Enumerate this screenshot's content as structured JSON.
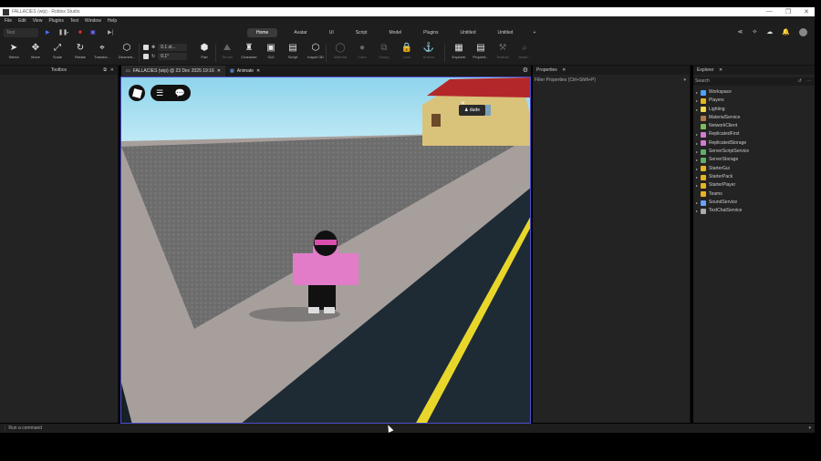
{
  "window": {
    "title": "FALLACIES (wip) - Roblox Studio",
    "controls": [
      "—",
      "❐",
      "✕"
    ]
  },
  "menu": [
    "File",
    "Edit",
    "View",
    "Plugins",
    "Test",
    "Window",
    "Help"
  ],
  "test_select": "Test",
  "ribbon_tabs": [
    {
      "label": "Home",
      "active": true
    },
    {
      "label": "Avatar",
      "active": false
    },
    {
      "label": "UI",
      "active": false
    },
    {
      "label": "Script",
      "active": false
    },
    {
      "label": "Model",
      "active": false
    },
    {
      "label": "Plugins",
      "active": false
    },
    {
      "label": "Untitled",
      "active": false
    },
    {
      "label": "Untitled",
      "active": false
    }
  ],
  "tools": [
    {
      "label": "Select",
      "icon": "cursor-icon",
      "glyph": "➤"
    },
    {
      "label": "Move",
      "icon": "move-icon",
      "glyph": "✥"
    },
    {
      "label": "Scale",
      "icon": "scale-icon",
      "glyph": "⤢"
    },
    {
      "label": "Rotate",
      "icon": "rotate-icon",
      "glyph": "↻"
    },
    {
      "label": "Transfor...",
      "icon": "transform-icon",
      "glyph": "⌖"
    },
    {
      "label": "Geometr...",
      "icon": "geometry-icon",
      "glyph": "⬡"
    },
    {
      "label": "Part",
      "icon": "part-icon",
      "glyph": "⬢"
    },
    {
      "label": "Terrain",
      "icon": "terrain-icon",
      "glyph": "⛰"
    },
    {
      "label": "Character",
      "icon": "character-icon",
      "glyph": "♜"
    },
    {
      "label": "GUI",
      "icon": "gui-icon",
      "glyph": "▣"
    },
    {
      "label": "Script",
      "icon": "script-icon",
      "glyph": "▤"
    },
    {
      "label": "Import 3D",
      "icon": "import-3d-icon",
      "glyph": "⬡"
    },
    {
      "label": "Material",
      "icon": "material-icon",
      "glyph": "◯"
    },
    {
      "label": "Color",
      "icon": "color-icon",
      "glyph": "●"
    },
    {
      "label": "Group",
      "icon": "group-icon",
      "glyph": "⧉"
    },
    {
      "label": "Lock",
      "icon": "lock-icon",
      "glyph": "🔒"
    },
    {
      "label": "Anchor",
      "icon": "anchor-icon",
      "glyph": "⚓"
    },
    {
      "label": "Explorer",
      "icon": "explorer-icon",
      "glyph": "▦"
    },
    {
      "label": "Properti...",
      "icon": "properties-icon",
      "glyph": "▤"
    },
    {
      "label": "Toolbox",
      "icon": "toolbox-icon",
      "glyph": "⚒"
    },
    {
      "label": "Asset...",
      "icon": "asset-icon",
      "glyph": "⌕"
    }
  ],
  "increments": {
    "move": "0.1 st...",
    "rotate": "0.1°"
  },
  "toolbox": {
    "title": "Toolbox"
  },
  "doc_tabs": [
    {
      "label": "FALLACIES (wip) @ 23 Dec 2025 19:16",
      "active": true
    },
    {
      "label": "Animate",
      "active": false
    }
  ],
  "viewport": {
    "tooltip": "dude"
  },
  "properties": {
    "title": "Properties",
    "filter": "Filter Properties (Ctrl+Shift+P)"
  },
  "explorer": {
    "title": "Explorer",
    "search": "Search",
    "items": [
      {
        "label": "Workspace",
        "color": "#4ea3ff"
      },
      {
        "label": "Players",
        "color": "#e6b422"
      },
      {
        "label": "Lighting",
        "color": "#f2d84b"
      },
      {
        "label": "MaterialService",
        "color": "#b07a4a"
      },
      {
        "label": "NetworkClient",
        "color": "#7cbf5a"
      },
      {
        "label": "ReplicatedFirst",
        "color": "#d07cd0"
      },
      {
        "label": "ReplicatedStorage",
        "color": "#d07cd0"
      },
      {
        "label": "ServerScriptService",
        "color": "#5fae6a"
      },
      {
        "label": "ServerStorage",
        "color": "#5fae6a"
      },
      {
        "label": "StarterGui",
        "color": "#e6b422"
      },
      {
        "label": "StarterPack",
        "color": "#e6b422"
      },
      {
        "label": "StarterPlayer",
        "color": "#e6b422"
      },
      {
        "label": "Teams",
        "color": "#e6b422"
      },
      {
        "label": "SoundService",
        "color": "#6aa0ff"
      },
      {
        "label": "TextChatService",
        "color": "#aaaaaa"
      }
    ]
  },
  "command_bar": {
    "placeholder": "Run a command"
  }
}
